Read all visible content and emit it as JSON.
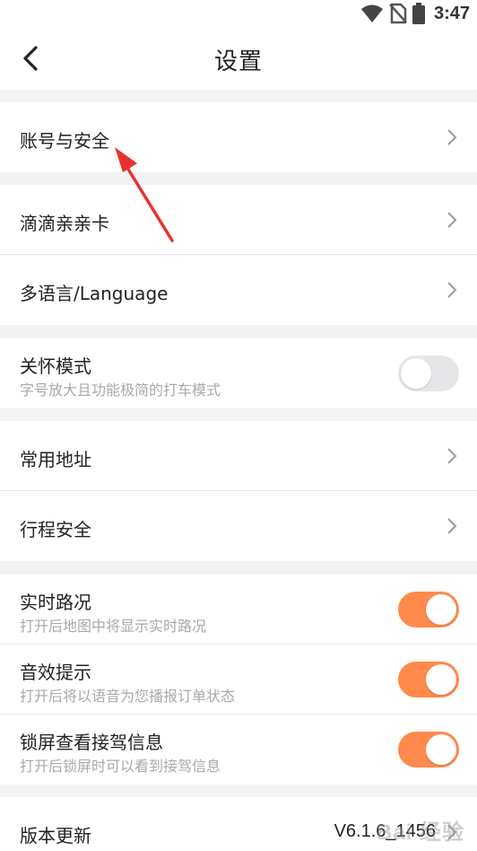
{
  "status_bar": {
    "time": "3:47",
    "icons": [
      "wifi-icon",
      "no-sim-icon",
      "battery-icon"
    ]
  },
  "nav": {
    "title": "设置",
    "back_icon": "chevron-left-icon"
  },
  "sections": {
    "account": {
      "label": "账号与安全"
    },
    "family_card": {
      "label": "滴滴亲亲卡"
    },
    "language": {
      "label": "多语言/Language"
    },
    "care_mode": {
      "label": "关怀模式",
      "sub": "字号放大且功能极简的打车模式",
      "enabled": false
    },
    "address": {
      "label": "常用地址"
    },
    "trip_safety": {
      "label": "行程安全"
    },
    "traffic": {
      "label": "实时路况",
      "sub": "打开后地图中将显示实时路况",
      "enabled": true
    },
    "sound": {
      "label": "音效提示",
      "sub": "打开后将以语音为您播报订单状态",
      "enabled": true
    },
    "lock_screen": {
      "label": "锁屏查看接驾信息",
      "sub": "打开后锁屏时可以看到接驾信息",
      "enabled": true
    },
    "version": {
      "label": "版本更新",
      "value": "V6.1.6_1456"
    }
  },
  "colors": {
    "accent": "#ff8a4c",
    "arrow": "#e8322f",
    "background": "#f3f3f5"
  },
  "watermark": {
    "text": "Bai 经验"
  }
}
